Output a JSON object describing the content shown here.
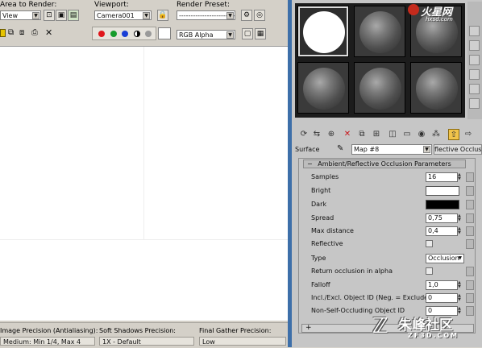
{
  "render_frame": {
    "area_label": "Area to Render:",
    "area_value": "View",
    "viewport_label": "Viewport:",
    "viewport_value": "Camera001",
    "preset_label": "Render Preset:",
    "preset_value": "-------------------------",
    "channel_value": "RGB Alpha",
    "status": {
      "image_precision_label": "Image Precision (Antialiasing):",
      "image_precision_value": "Medium: Min 1/4, Max 4",
      "soft_shadows_label": "Soft Shadows Precision:",
      "soft_shadows_value": "1X - Default",
      "final_gather_label": "Final Gather Precision:",
      "final_gather_value": "Low"
    },
    "colors": {
      "red": "#e0161b",
      "green": "#169c2c",
      "blue": "#1a3fd6",
      "render_bg": "#ffffff"
    }
  },
  "material_editor": {
    "surface_label": "Surface",
    "map_name": "Map #8",
    "map_type": "flective Occlusion",
    "rollout_title": "Ambient/Reflective Occlusion Parameters",
    "params": {
      "samples_label": "Samples",
      "samples_value": "16",
      "bright_label": "Bright",
      "bright_color": "#ffffff",
      "dark_label": "Dark",
      "dark_color": "#000000",
      "spread_label": "Spread",
      "spread_value": "0,75",
      "max_distance_label": "Max distance",
      "max_distance_value": "0,4",
      "reflective_label": "Reflective",
      "type_label": "Type",
      "type_value": "Occlusion",
      "return_alpha_label": "Return occlusion in alpha",
      "falloff_label": "Falloff",
      "falloff_value": "1,0",
      "incl_excl_label": "Incl./Excl. Object ID (Neg. = Exclude)",
      "incl_excl_value": "0",
      "non_self_label": "Non-Self-Occluding Object ID",
      "non_self_value": "0"
    },
    "bottom_rollout_sign": "+",
    "slot_count": 6
  },
  "watermarks": {
    "top_text": "火星网",
    "top_sub": "hxsd.com",
    "bottom_text": "朱峰社区",
    "bottom_sub": "ZF3D.COM"
  }
}
